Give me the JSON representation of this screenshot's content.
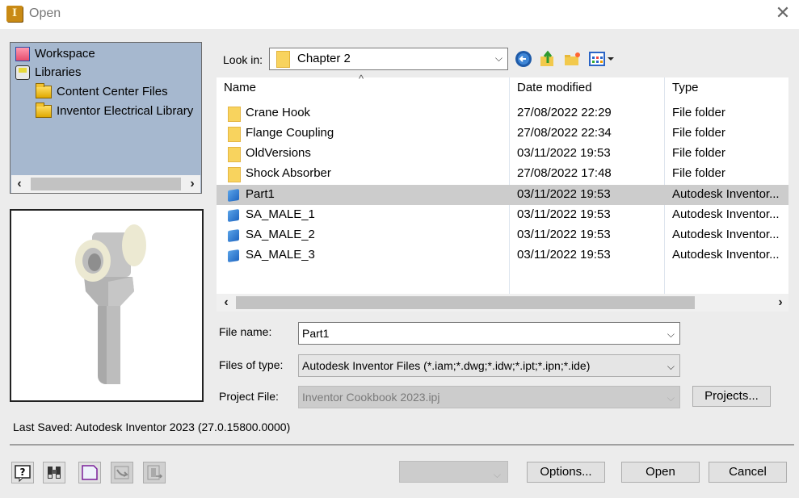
{
  "window": {
    "title": "Open",
    "app_icon": "autodesk-inventor-icon",
    "close_icon": "close-icon"
  },
  "locations": {
    "items": [
      {
        "label": "Workspace",
        "icon": "workspace-icon",
        "indent": 0
      },
      {
        "label": "Libraries",
        "icon": "libraries-icon",
        "indent": 0
      },
      {
        "label": "Content Center Files",
        "icon": "folder-icon",
        "indent": 1
      },
      {
        "label": "Inventor Electrical Library",
        "icon": "folder-icon",
        "indent": 1
      }
    ],
    "scroll_left": "‹",
    "scroll_right": "›"
  },
  "look_in": {
    "label": "Look in:",
    "value": "Chapter 2"
  },
  "toolbar": {
    "back": "back-icon",
    "up": "up-folder-icon",
    "new_folder": "new-folder-icon",
    "views": "view-menu-icon"
  },
  "file_list": {
    "columns": [
      "Name",
      "Date modified",
      "Type"
    ],
    "sorted_by": "Name",
    "rows": [
      {
        "name": "Crane Hook",
        "date": "27/08/2022 22:29",
        "type": "File folder",
        "kind": "folder",
        "selected": false
      },
      {
        "name": "Flange Coupling",
        "date": "27/08/2022 22:34",
        "type": "File folder",
        "kind": "folder",
        "selected": false
      },
      {
        "name": "OldVersions",
        "date": "03/11/2022 19:53",
        "type": "File folder",
        "kind": "folder",
        "selected": false
      },
      {
        "name": "Shock Absorber",
        "date": "27/08/2022 17:48",
        "type": "File folder",
        "kind": "folder",
        "selected": false
      },
      {
        "name": "Part1",
        "date": "03/11/2022 19:53",
        "type": "Autodesk Inventor...",
        "kind": "part",
        "selected": true
      },
      {
        "name": "SA_MALE_1",
        "date": "03/11/2022 19:53",
        "type": "Autodesk Inventor...",
        "kind": "part",
        "selected": false
      },
      {
        "name": "SA_MALE_2",
        "date": "03/11/2022 19:53",
        "type": "Autodesk Inventor...",
        "kind": "part",
        "selected": false
      },
      {
        "name": "SA_MALE_3",
        "date": "03/11/2022 19:53",
        "type": "Autodesk Inventor...",
        "kind": "part",
        "selected": false
      }
    ]
  },
  "form": {
    "file_name_label": "File name:",
    "file_name_value": "Part1",
    "files_of_type_label": "Files of type:",
    "files_of_type_value": "Autodesk Inventor Files (*.iam;*.dwg;*.idw;*.ipt;*.ipn;*.ide)",
    "project_file_label": "Project File:",
    "project_file_value": "Inventor Cookbook 2023.ipj",
    "projects_button": "Projects..."
  },
  "last_saved": "Last Saved: Autodesk Inventor 2023 (27.0.15800.0000)",
  "bottom": {
    "icons": [
      "help-icon",
      "find-icon",
      "new-file-icon",
      "import-icon",
      "export-icon"
    ],
    "options_button": "Options...",
    "open_button": "Open",
    "cancel_button": "Cancel"
  },
  "colors": {
    "tree_bg": "#a6b8cf",
    "selection": "#cccccc",
    "folder": "#f8d35e",
    "part": "#2f7ad6"
  }
}
